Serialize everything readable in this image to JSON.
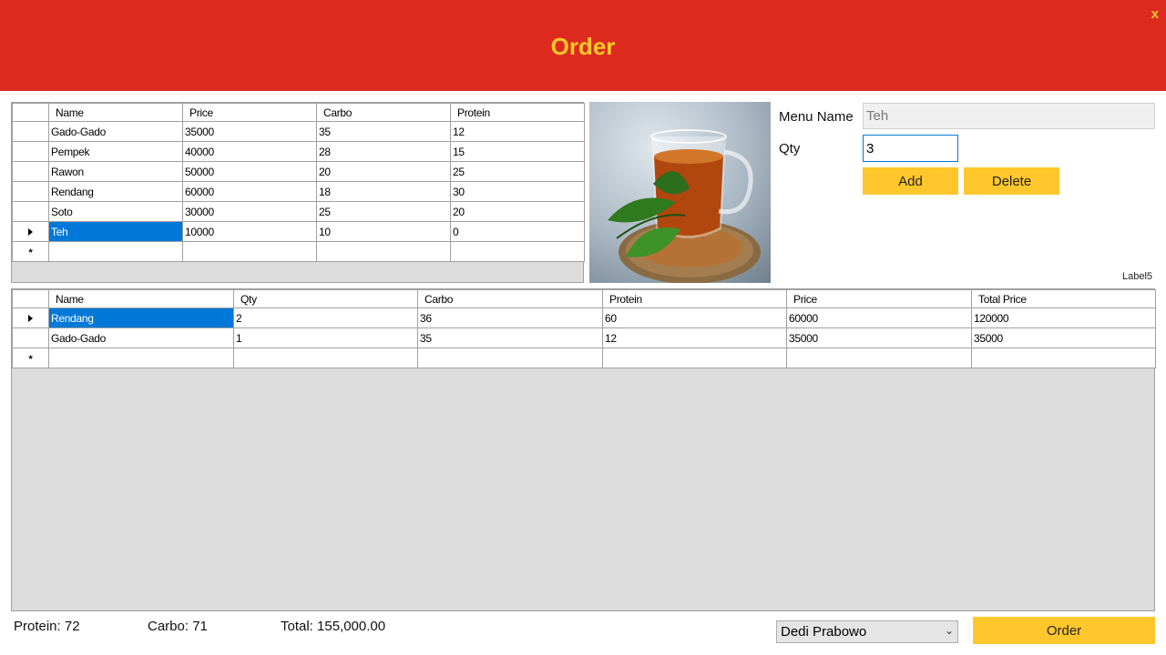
{
  "header": {
    "title": "Order",
    "close_label": "x"
  },
  "menu_grid": {
    "columns": [
      "Name",
      "Price",
      "Carbo",
      "Protein"
    ],
    "rows": [
      [
        "Gado-Gado",
        "35000",
        "35",
        "12"
      ],
      [
        "Pempek",
        "40000",
        "28",
        "15"
      ],
      [
        "Rawon",
        "50000",
        "20",
        "25"
      ],
      [
        "Rendang",
        "60000",
        "18",
        "30"
      ],
      [
        "Soto",
        "30000",
        "25",
        "20"
      ],
      [
        "Teh",
        "10000",
        "10",
        "0"
      ]
    ],
    "selected_row": 5
  },
  "form": {
    "menu_name_label": "Menu Name",
    "menu_name_value": "Teh",
    "qty_label": "Qty",
    "qty_value": "3",
    "add_label": "Add",
    "delete_label": "Delete",
    "label5": "Label5"
  },
  "order_grid": {
    "columns": [
      "Name",
      "Qty",
      "Carbo",
      "Protein",
      "Price",
      "Total Price"
    ],
    "rows": [
      [
        "Rendang",
        "2",
        "36",
        "60",
        "60000",
        "120000"
      ],
      [
        "Gado-Gado",
        "1",
        "35",
        "12",
        "35000",
        "35000"
      ]
    ],
    "selected_row": 0
  },
  "footer": {
    "protein": "Protein: 72",
    "carbo": "Carbo: 71",
    "total": "Total: 155,000.00",
    "customer": "Dedi Prabowo",
    "order_label": "Order"
  },
  "icons": {
    "row_current": "row-pointer-icon",
    "new_row": "new-row-icon",
    "dropdown": "chevron-down-icon"
  },
  "colors": {
    "header_bg": "#dc2b1e",
    "accent": "#ffc72c",
    "selection": "#0078d7"
  }
}
